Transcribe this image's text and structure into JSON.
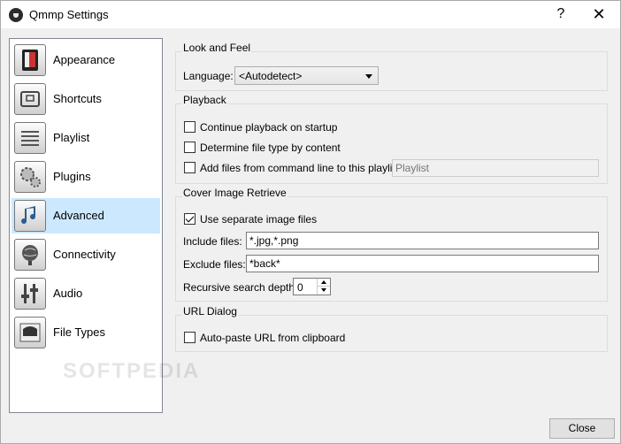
{
  "window": {
    "title": "Qmmp Settings",
    "help_glyph": "?",
    "close_glyph": "✕"
  },
  "sidebar": {
    "selected": "Advanced",
    "items": [
      {
        "label": "Appearance",
        "icon": "appearance-icon"
      },
      {
        "label": "Shortcuts",
        "icon": "shortcuts-icon"
      },
      {
        "label": "Playlist",
        "icon": "playlist-icon"
      },
      {
        "label": "Plugins",
        "icon": "plugins-icon"
      },
      {
        "label": "Advanced",
        "icon": "advanced-icon"
      },
      {
        "label": "Connectivity",
        "icon": "connectivity-icon"
      },
      {
        "label": "Audio",
        "icon": "audio-icon"
      },
      {
        "label": "File Types",
        "icon": "file-types-icon"
      }
    ]
  },
  "look_and_feel": {
    "title": "Look and Feel",
    "language_label": "Language:",
    "language_value": "<Autodetect>"
  },
  "playback": {
    "title": "Playback",
    "continue_label": "Continue playback on startup",
    "continue_checked": false,
    "determine_label": "Determine file type by content",
    "determine_checked": false,
    "add_files_label": "Add files from command line to this playlist:",
    "add_files_checked": false,
    "playlist_placeholder": "Playlist"
  },
  "cover": {
    "title": "Cover Image Retrieve",
    "separate_label": "Use separate image files",
    "separate_checked": true,
    "include_label": "Include files:",
    "include_value": "*.jpg,*.png",
    "exclude_label": "Exclude files:",
    "exclude_value": "*back*",
    "depth_label": "Recursive search depth:",
    "depth_value": "0"
  },
  "url_dialog": {
    "title": "URL Dialog",
    "autopaste_label": "Auto-paste URL from clipboard",
    "autopaste_checked": false
  },
  "footer": {
    "close_label": "Close"
  },
  "watermark": "SOFTPEDIA"
}
